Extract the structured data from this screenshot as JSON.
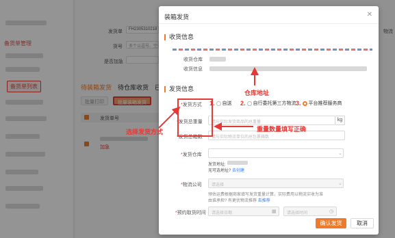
{
  "background": {
    "sidebar": {
      "section_title": "备货单管理",
      "active_item": "备货单列表"
    },
    "filters": {
      "shipment_no_label": "发货单",
      "shipment_no_value": "FH2305310218",
      "product_no_label": "货号",
      "product_no_placeholder": "多个以逗号、空格分隔",
      "urgent_label": "是否加急",
      "right_label": "物流"
    },
    "tabs": [
      "待装箱发货",
      "待仓库收货",
      "已"
    ],
    "buttons": {
      "batch_print": "批量打印",
      "batch_pack_ship": "批量装箱发货"
    },
    "table": {
      "col_shipment_no": "发货单号",
      "urgent_tag": "加急"
    }
  },
  "modal": {
    "title": "装箱发货",
    "close_icon": "close-icon",
    "receive_section": {
      "title": "收货信息",
      "warehouse_label": "收货仓库",
      "info_label": "收货信息"
    },
    "ship_section": {
      "title": "发货信息",
      "method_label": "发货方式",
      "methods": [
        {
          "label": "自送",
          "num": "1."
        },
        {
          "label": "自行委托第三方物流",
          "num": "2."
        },
        {
          "label": "平台推荐服务商",
          "num": "3."
        }
      ],
      "selected_method_index": 2,
      "weight_label": "发货总重量",
      "weight_placeholder": "请与实际发货商品的总重量",
      "weight_unit": "kg",
      "box_count_label": "发货总箱数",
      "box_count_placeholder": "请与实际物流单位的总包裹箱数",
      "warehouse_label": "发货仓库",
      "ship_address_label": "发货地址:",
      "no_address_text": "无可选地址?",
      "add_link": "去创建",
      "logistics_label": "物流公司",
      "logistics_placeholder": "请选择",
      "logistics_note_1": "预估运费根据商家填写发货重量计算，实际费用以物流",
      "logistics_note_2": "实收为准",
      "logistics_note_3": "由谁承担? 有更优物流推荐",
      "logistics_link": "去推荐",
      "pickup_time_label": "预约取货时间",
      "date_placeholder": "请选择日期",
      "time_placeholder": "请选择时间"
    },
    "confirm_button": "确认发货",
    "cancel_button": "取消"
  },
  "annotations": {
    "warehouse_address": "仓库地址",
    "choose_ship_method": "选择发货方式",
    "fill_weight_qty": "重量数量填写正确"
  },
  "colors": {
    "accent": "#ee7b2a",
    "annotation_red": "#e53935",
    "link_blue": "#3f7ee8"
  }
}
